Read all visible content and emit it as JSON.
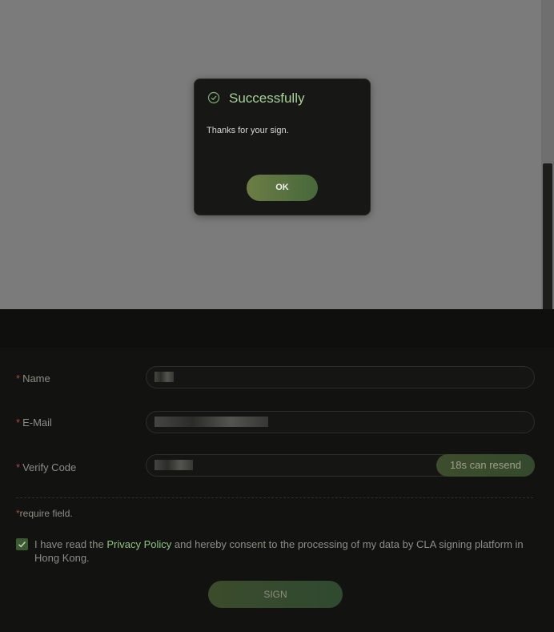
{
  "dialog": {
    "title": "Successfully",
    "message": "Thanks for your sign.",
    "ok_label": "OK",
    "icon": "check-circle-icon"
  },
  "form": {
    "name": {
      "label": "Name",
      "required_mark": "*"
    },
    "email": {
      "label": "E-Mail",
      "required_mark": "*"
    },
    "verify": {
      "label": "Verify Code",
      "required_mark": "*",
      "resend_label": "18s can resend"
    },
    "require_note": {
      "mark": "*",
      "text": "require field."
    },
    "consent": {
      "before": "I have read the ",
      "link": "Privacy Policy",
      "after": " and hereby consent to the processing of my data by CLA signing platform in Hong Kong.",
      "checked": true
    },
    "sign_label": "SIGN"
  },
  "colors": {
    "accent": "#a6d19a",
    "button_gradient_start": "#6c7d45",
    "button_gradient_end": "#47683b",
    "required": "#a64a3d"
  }
}
